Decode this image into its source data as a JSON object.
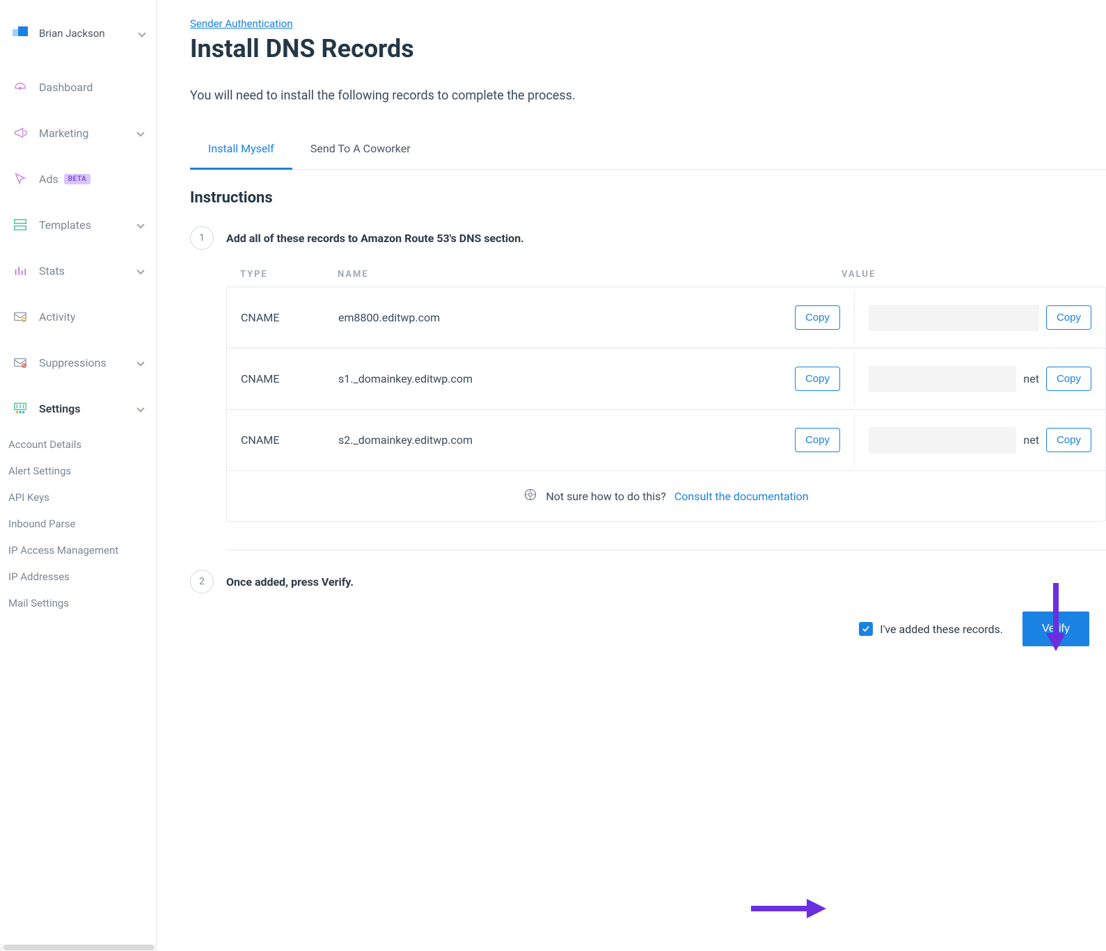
{
  "user": {
    "name": "Brian Jackson"
  },
  "sidebar": {
    "items": [
      {
        "id": "dashboard",
        "label": "Dashboard",
        "chev": false
      },
      {
        "id": "marketing",
        "label": "Marketing",
        "chev": true
      },
      {
        "id": "ads",
        "label": "Ads",
        "chev": false,
        "badge": "BETA"
      },
      {
        "id": "templates",
        "label": "Templates",
        "chev": true
      },
      {
        "id": "stats",
        "label": "Stats",
        "chev": true
      },
      {
        "id": "activity",
        "label": "Activity",
        "chev": false
      },
      {
        "id": "suppressions",
        "label": "Suppressions",
        "chev": true
      },
      {
        "id": "settings",
        "label": "Settings",
        "chev": true,
        "active": true
      }
    ],
    "settings_sub": [
      "Account Details",
      "Alert Settings",
      "API Keys",
      "Inbound Parse",
      "IP Access Management",
      "IP Addresses",
      "Mail Settings"
    ]
  },
  "breadcrumb": "Sender Authentication",
  "page_title": "Install DNS Records",
  "intro": "You will need to install the following records to complete the process.",
  "tabs": [
    {
      "id": "install",
      "label": "Install Myself",
      "active": true
    },
    {
      "id": "send",
      "label": "Send To A Coworker",
      "active": false
    }
  ],
  "section_title": "Instructions",
  "step1": {
    "num": "1",
    "label": "Add all of these records to Amazon Route 53's DNS section."
  },
  "columns": {
    "type": "TYPE",
    "name": "NAME",
    "value": "VALUE"
  },
  "records": [
    {
      "type": "CNAME",
      "name": "em8800.editwp.com",
      "value_suffix": ""
    },
    {
      "type": "CNAME",
      "name": "s1._domainkey.editwp.com",
      "value_suffix": "net"
    },
    {
      "type": "CNAME",
      "name": "s2._domainkey.editwp.com",
      "value_suffix": "net"
    }
  ],
  "copy_label": "Copy",
  "doc_hint": {
    "text": "Not sure how to do this?",
    "link": "Consult the documentation"
  },
  "step2": {
    "num": "2",
    "label": "Once added, press Verify."
  },
  "checkbox_label": "I've added these records.",
  "verify_label": "Verify"
}
